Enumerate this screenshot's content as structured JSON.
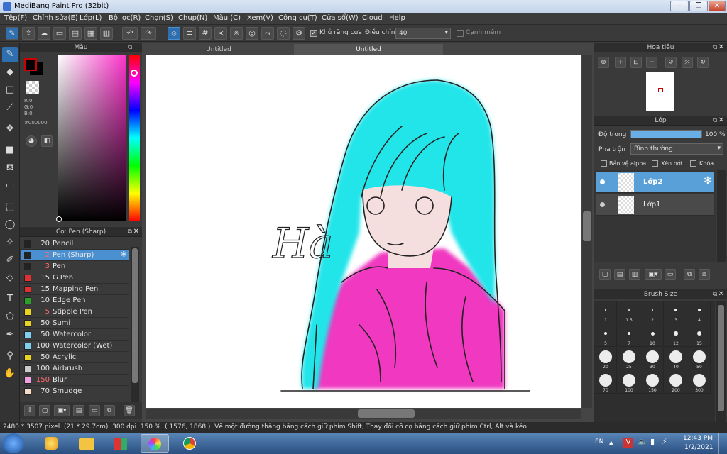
{
  "window": {
    "title": "MediBang Paint Pro (32bit)",
    "minimize": "–",
    "maximize": "❐",
    "close": "✕"
  },
  "menu": [
    "Tệp(F)",
    "Chỉnh sửa(E)",
    "Lớp(L)",
    "Bộ lọc(R)",
    "Chọn(S)",
    "Chụp(N)",
    "Màu (C)",
    "Xem(V)",
    "Công cụ(T)",
    "Cửa sổ(W)",
    "Cloud",
    "Help"
  ],
  "toolbar": {
    "antialias_label": "Khử răng cưa",
    "adjust_label": "Điều chỉnh",
    "adjust_value": "40",
    "soften_label": "Cạnh mềm",
    "icons": [
      "brush-icon",
      "export-icon",
      "speech-icon",
      "speech2-icon",
      "panel-icon",
      "panel2-icon",
      "grid-icon"
    ],
    "undo": "↶",
    "redo": "↷"
  },
  "color_panel": {
    "title": "Màu",
    "r": "R:0",
    "g": "G:0",
    "b": "B:0",
    "hex": "#000000",
    "fg": "#cc0000",
    "bg": "#000000",
    "accent": "#ff33cc"
  },
  "brush_panel": {
    "title": "Cọ: Pen (Sharp)",
    "items": [
      {
        "size": "20",
        "name": "Pencil",
        "color": "#222222"
      },
      {
        "size": "2",
        "name": "Pen (Sharp)",
        "color": "#222222",
        "selected": true
      },
      {
        "size": "3",
        "name": "Pen",
        "color": "#222222"
      },
      {
        "size": "15",
        "name": "G Pen",
        "color": "#e23030"
      },
      {
        "size": "15",
        "name": "Mapping Pen",
        "color": "#e23030"
      },
      {
        "size": "10",
        "name": "Edge Pen",
        "color": "#2aa02a"
      },
      {
        "size": "5",
        "name": "Stipple Pen",
        "color": "#e8d420"
      },
      {
        "size": "50",
        "name": "Sumi",
        "color": "#e8d420"
      },
      {
        "size": "50",
        "name": "Watercolor",
        "color": "#7fd0f0"
      },
      {
        "size": "100",
        "name": "Watercolor (Wet)",
        "color": "#7fd0f0"
      },
      {
        "size": "50",
        "name": "Acrylic",
        "color": "#e8d420"
      },
      {
        "size": "100",
        "name": "Airbrush",
        "color": "#cccccc"
      },
      {
        "size": "150",
        "name": "Blur",
        "color": "#f0a0e0"
      },
      {
        "size": "70",
        "name": "Smudge",
        "color": "#f5dcc8"
      }
    ]
  },
  "tabs": [
    "Untitled",
    "Untitled"
  ],
  "canvas": {
    "signature": "Hà"
  },
  "navigator": {
    "title": "Hoa tiêu"
  },
  "layers": {
    "title": "Lớp",
    "opacity_label": "Độ trong",
    "opacity_value": "100 %",
    "opacity_fraction": 1.0,
    "blend_label": "Pha trộn",
    "blend_value": "Bình thường",
    "alpha_lock": "Bảo vệ alpha",
    "clipping": "Xén bớt",
    "lock": "Khóa",
    "items": [
      {
        "name": "Lớp2",
        "selected": true
      },
      {
        "name": "Lớp1",
        "selected": false
      }
    ]
  },
  "brush_size": {
    "title": "Brush Size",
    "sizes": [
      "1",
      "1.5",
      "2",
      "3",
      "4",
      "5",
      "7",
      "10",
      "12",
      "15",
      "20",
      "25",
      "30",
      "40",
      "50",
      "70",
      "100",
      "150",
      "200",
      "300"
    ]
  },
  "status": {
    "dimensions": "2480 * 3507 pixel",
    "size_cm": "(21 * 29.7cm)",
    "dpi": "300 dpi",
    "zoom": "150 %",
    "coords": "( 1576, 1868 )",
    "hint": "Vẽ một đường thẳng bằng cách giữ phím Shift, Thay đổi cỡ cọ bằng cách giữ phím Ctrl, Alt và kéo"
  },
  "taskbar": {
    "lang": "EN",
    "time": "12:43 PM",
    "date": "1/2/2021"
  }
}
